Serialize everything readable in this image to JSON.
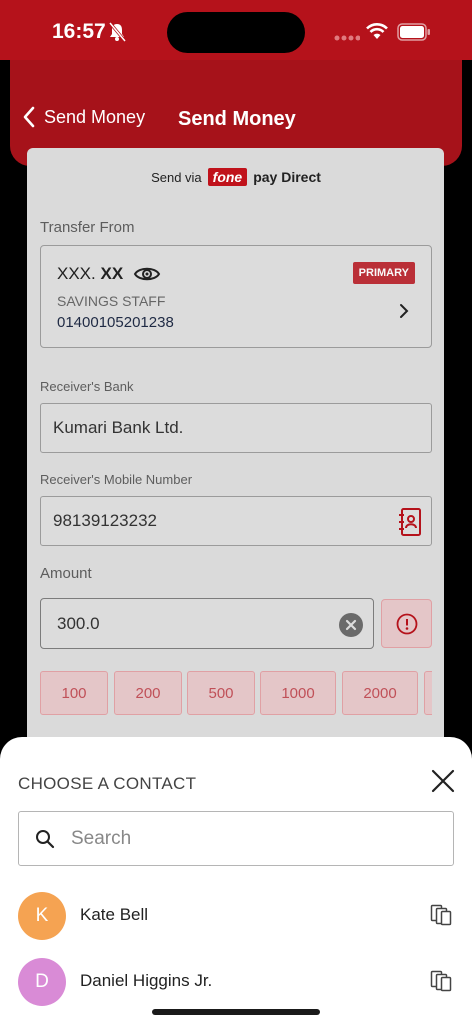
{
  "status": {
    "time": "16:57"
  },
  "header": {
    "back_label": "Send Money",
    "title": "Send Money"
  },
  "send_via": {
    "prefix": "Send via",
    "brand": "fone",
    "suffix": "pay Direct"
  },
  "transfer_from": {
    "label": "Transfer From",
    "mask_prefix": "XXX.",
    "mask_bold": "XX",
    "badge": "PRIMARY",
    "account_type": "SAVINGS STAFF",
    "account_number": "01400105201238"
  },
  "receiver_bank": {
    "label": "Receiver's Bank",
    "value": "Kumari Bank Ltd."
  },
  "receiver_mobile": {
    "label": "Receiver's Mobile Number",
    "value": "98139123232"
  },
  "amount": {
    "label": "Amount",
    "value": "300.0"
  },
  "quick_amounts": [
    "100",
    "200",
    "500",
    "1000",
    "2000"
  ],
  "contact_sheet": {
    "title": "CHOOSE A CONTACT",
    "search_placeholder": "Search",
    "contacts": [
      {
        "initial": "K",
        "name": "Kate Bell",
        "color": "#f5a352"
      },
      {
        "initial": "D",
        "name": "Daniel Higgins Jr.",
        "color": "#d98bd6"
      }
    ]
  },
  "colors": {
    "brand_red": "#b5121b",
    "header_red": "#a6121a"
  }
}
